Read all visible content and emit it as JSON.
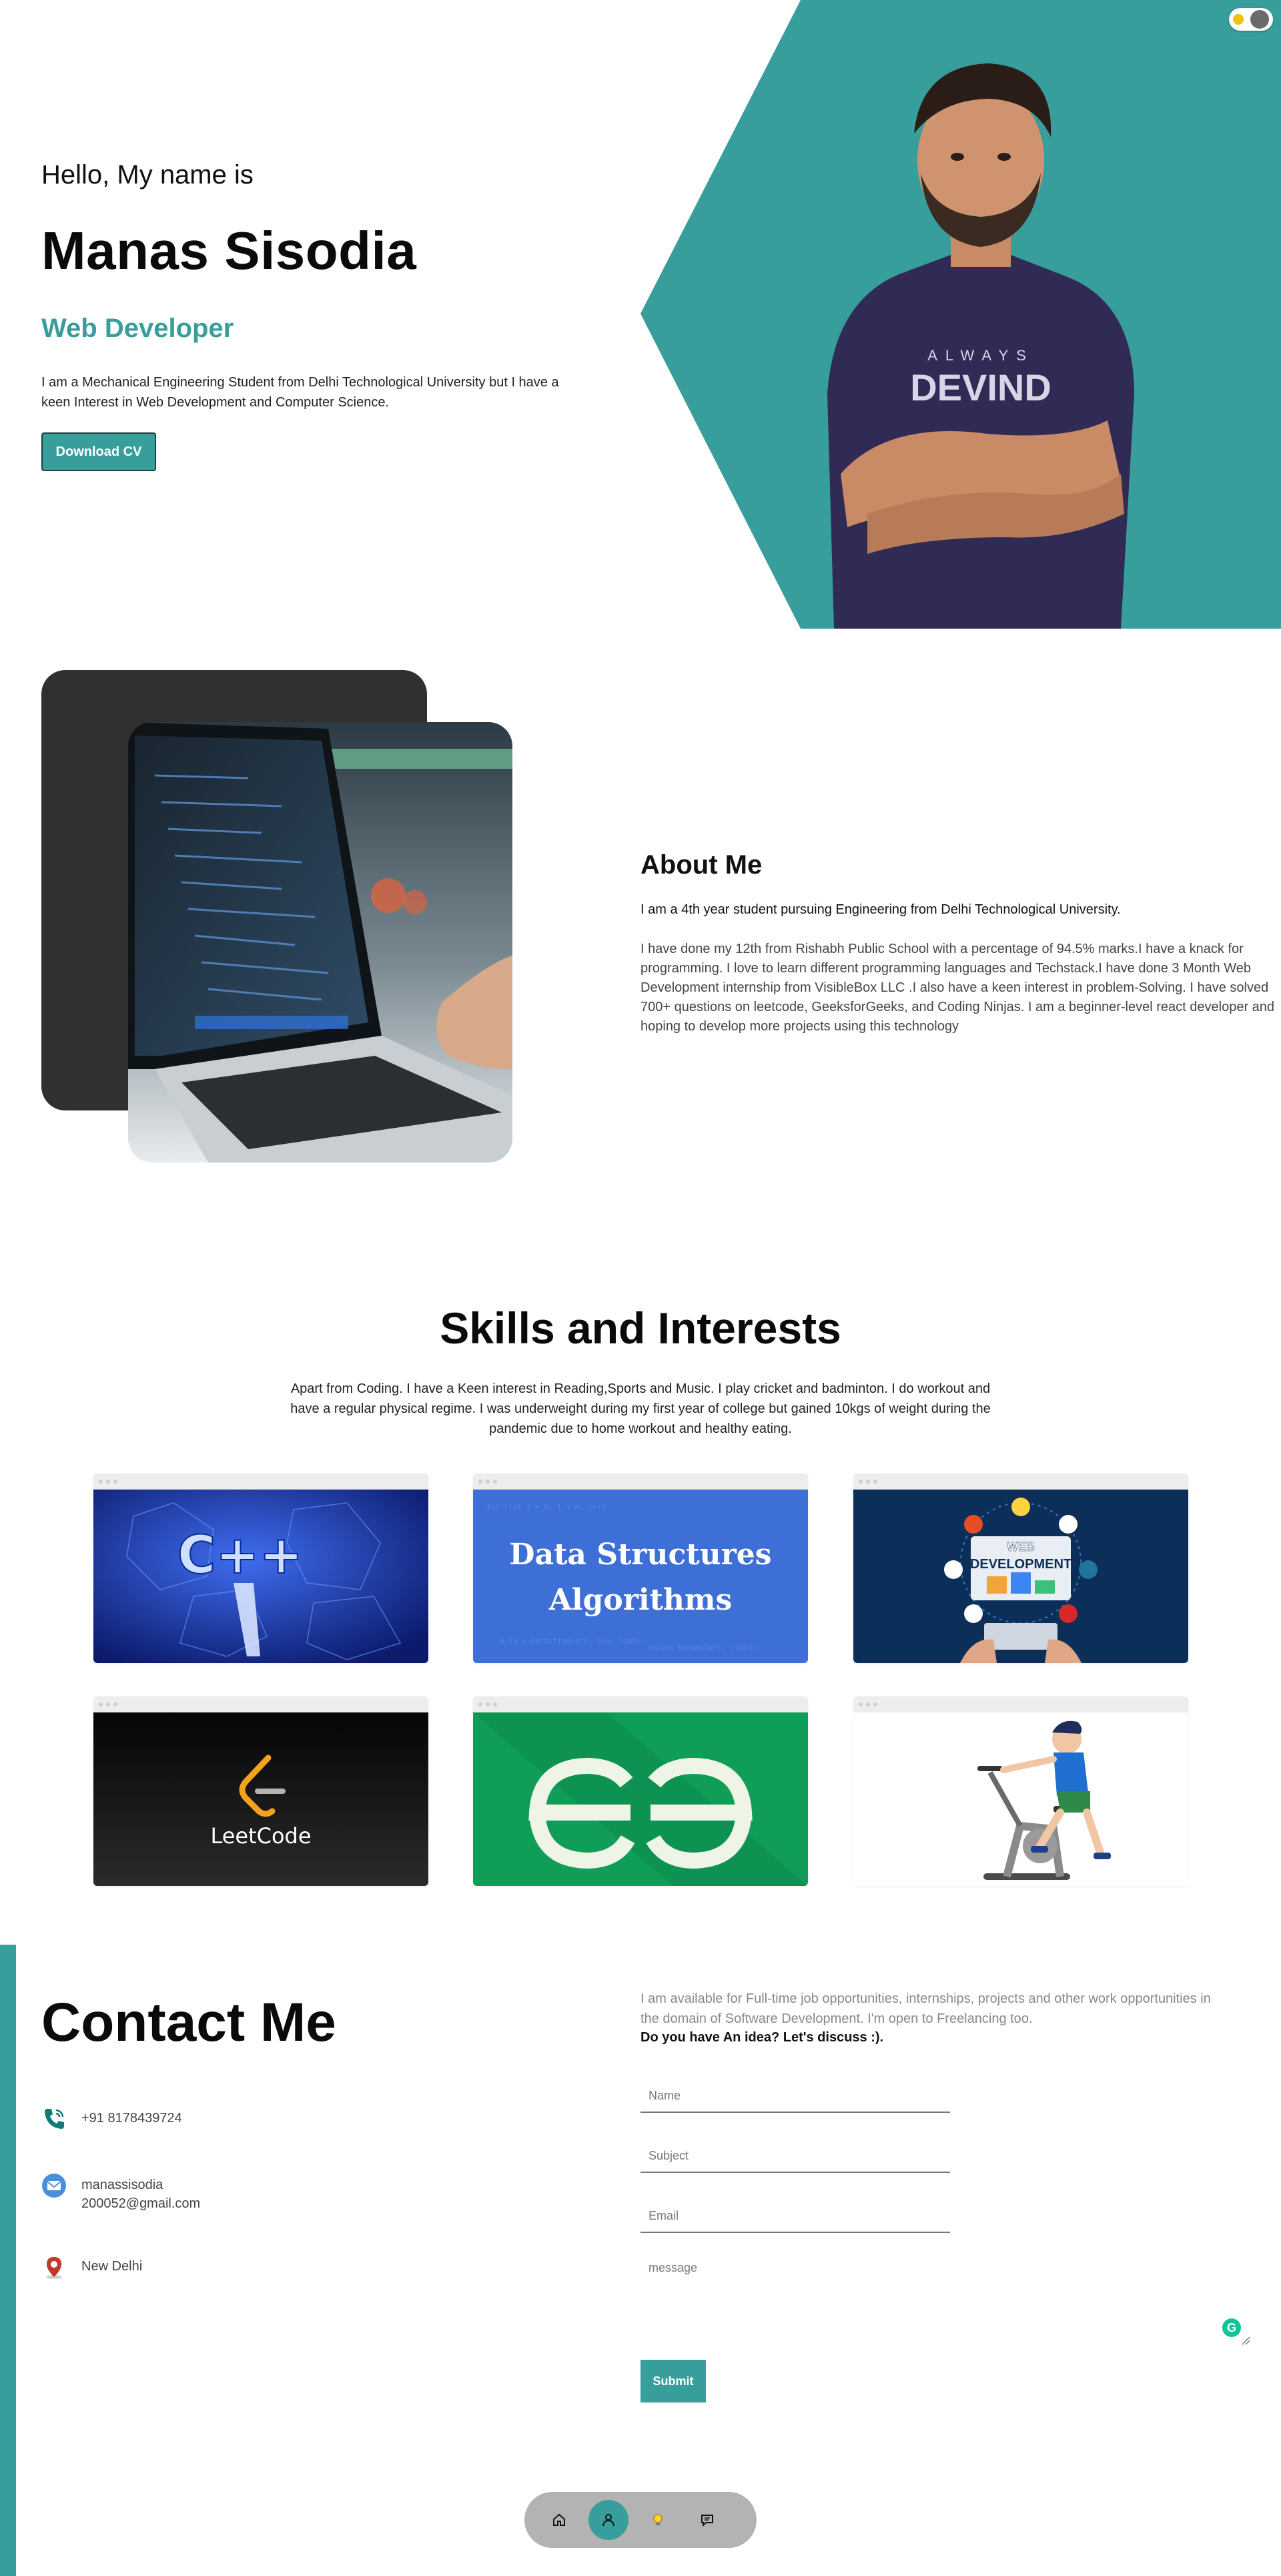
{
  "hero": {
    "greeting": "Hello, My name is",
    "name": "Manas Sisodia",
    "role": "Web Developer",
    "description": "I am a Mechanical Engineering Student from Delhi Technological University but I have a keen Interest in Web Development and Computer Science.",
    "cv_button": "Download CV",
    "shirt_text": "ALWAYS\nDEVIND"
  },
  "about": {
    "title": "About Me",
    "p1": "I am a 4th year student pursuing Engineering from Delhi Technological University.",
    "p2": "I have done my 12th from Rishabh Public School with a percentage of 94.5% marks.I have a knack for programming. I love to learn different programming languages and Techstack.I have done 3 Month Web Development internship from VisibleBox LLC .I also have a keen interest in problem-Solving. I have solved 700+ questions on leetcode, GeeksforGeeks, and Coding Ninjas. I am a beginner-level react developer and hoping to develop more projects using this technology"
  },
  "skills": {
    "title": "Skills and Interests",
    "description": "Apart from Coding. I have a Keen interest in Reading,Sports and Music. I play cricket and badminton. I do workout and have a regular physical regime. I was underweight during my first year of college but gained 10kgs of weight during the pandemic due to home workout and healthy eating.",
    "cards": [
      {
        "label": "C++"
      },
      {
        "label_line1": "Data Structures",
        "label_line2": "Algorithms"
      },
      {
        "label_line1": "WEB",
        "label_line2": "DEVELOPMENT"
      },
      {
        "label": "LeetCode"
      },
      {
        "label": "GG"
      },
      {
        "label": "cycling"
      }
    ]
  },
  "contact": {
    "title": "Contact Me",
    "phone": "+91 8178439724",
    "email_line1": "manassisodia",
    "email_line2": "200052@gmail.com",
    "location": "New Delhi",
    "intro": "I am available for Full-time job opportunities, internships, projects and other work opportunities in the domain of Software Development. I'm open to Freelancing too.",
    "cta": "Do you have An idea? Let's discuss :).",
    "name_placeholder": "Name",
    "subject_placeholder": "Subject",
    "email_placeholder": "Email",
    "message_placeholder": "message",
    "submit_label": "Submit",
    "grammarly_glyph": "G"
  },
  "nav": {
    "items": [
      "home-icon",
      "user-icon",
      "bulb-icon",
      "message-icon"
    ],
    "active": "user-icon"
  },
  "colors": {
    "accent": "#379e9c",
    "dark_card": "#303030",
    "nav_bg": "#b3b3b3"
  }
}
